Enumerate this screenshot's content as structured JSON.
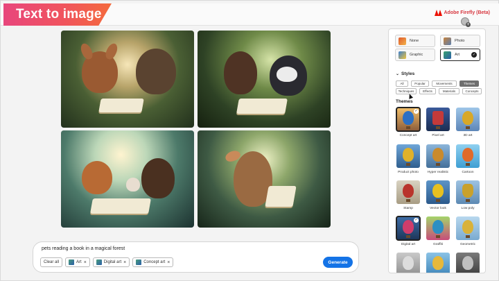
{
  "header": {
    "title": "Text to image",
    "brand": "Adobe Firefly (Beta)"
  },
  "prompt": {
    "text": "pets reading a book in a magical forest",
    "clear_label": "Clear all",
    "chips": [
      "Art",
      "Digital art",
      "Concept art"
    ],
    "generate_label": "Generate"
  },
  "content_type": {
    "options": [
      {
        "label": "None",
        "selected": false
      },
      {
        "label": "Photo",
        "selected": false
      },
      {
        "label": "Graphic",
        "selected": false
      },
      {
        "label": "Art",
        "selected": true
      }
    ]
  },
  "styles": {
    "heading": "Styles",
    "tabs": [
      "All",
      "Popular",
      "Movements",
      "Themes",
      "Techniques",
      "Effects",
      "Materials",
      "Concepts"
    ],
    "active_tab": "Themes"
  },
  "themes": {
    "heading": "Themes",
    "items": [
      {
        "label": "Concept art",
        "selected": true,
        "color": "#2b6fc4"
      },
      {
        "label": "Pixel art",
        "selected": false,
        "color": "#c43a3a"
      },
      {
        "label": "3D art",
        "selected": false,
        "color": "#d8a828"
      },
      {
        "label": "Product photo",
        "selected": false,
        "color": "#e0b12a"
      },
      {
        "label": "Hyper realistic",
        "selected": false,
        "color": "#c98a2c"
      },
      {
        "label": "Cartoon",
        "selected": false,
        "color": "#e06a2a"
      },
      {
        "label": "Stamp",
        "selected": false,
        "color": "#b9342c"
      },
      {
        "label": "Vector look",
        "selected": false,
        "color": "#e8c020"
      },
      {
        "label": "Low poly",
        "selected": false,
        "color": "#c9a12c"
      },
      {
        "label": "Digital art",
        "selected": true,
        "color": "#cf3d6b"
      },
      {
        "label": "Graffiti",
        "selected": false,
        "color": "#2d8fc2"
      },
      {
        "label": "Geometric",
        "selected": false,
        "color": "#d9b23a"
      }
    ]
  },
  "colors": {
    "banner_start": "#e8467c",
    "banner_end": "#f46a3c",
    "accent": "#1473e6",
    "brand": "#d7373f"
  }
}
